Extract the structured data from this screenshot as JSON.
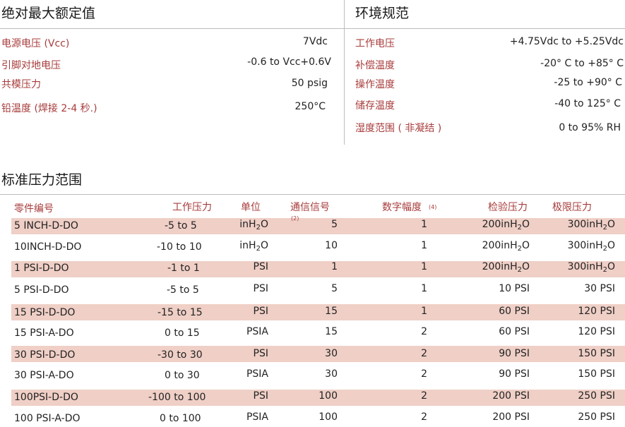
{
  "abs_max": {
    "title": "绝对最大额定值",
    "items": [
      {
        "label": "电源电压  (Vcc)",
        "value": "7Vdc"
      },
      {
        "label": "引脚对地电压",
        "value": "-0.6  to  Vcc+0.6V"
      },
      {
        "label": "共模压力",
        "value": "50  psig"
      },
      {
        "label": "铅温度  (焊接  2-4  秒.)",
        "value": "250°C"
      }
    ]
  },
  "env": {
    "title": "环境规范",
    "items": [
      {
        "label": "工作电压",
        "value": "+4.75Vdc   to  +5.25Vdc"
      },
      {
        "label": "补偿温度",
        "value": "-20°  C to  +85°  C"
      },
      {
        "label": "操作温度",
        "value": "-25  to  +90°  C"
      },
      {
        "label": "储存温度",
        "value": "-40  to 125°  C"
      },
      {
        "label": "湿度范围 ( 非凝结 )",
        "value": "0  to 95%   RH"
      }
    ]
  },
  "std": {
    "title": "标准压力范围",
    "headers": {
      "part": "零件编号",
      "range": "工作压力",
      "unit": "单位",
      "comm": "通信信号",
      "comm_note": "(2)",
      "digits": "数字幅度",
      "digits_note": "(4)",
      "proof": "检验压力",
      "burst": "极限压力"
    },
    "unit_inh2o": {
      "base": "inH",
      "sub": "2",
      "tail": "O"
    },
    "rows": [
      {
        "part": "5  INCH-D-DO",
        "range": "-5  to 5",
        "unit": "inH2O",
        "comm": "5",
        "digits": "1",
        "proof": "200inH2O",
        "burst": "300inH2O"
      },
      {
        "part": "10INCH-D-DO",
        "range": "-10 to 10",
        "unit": "inH2O",
        "comm": "10",
        "digits": "1",
        "proof": "200inH2O",
        "burst": "300inH2O"
      },
      {
        "part": "1 PSI-D-DO",
        "range": "-1 to 1",
        "unit": "PSI",
        "comm": "1",
        "digits": "1",
        "proof": "200inH2O",
        "burst": "300inH2O"
      },
      {
        "part": "5 PSI-D-DO",
        "range": "-5 to 5",
        "unit": "PSI",
        "comm": "5",
        "digits": "1",
        "proof": "10 PSI",
        "burst": "30 PSI"
      },
      {
        "part": "15  PSI-D-DO",
        "range": "-15 to 15",
        "unit": "PSI",
        "comm": "15",
        "digits": "1",
        "proof": "60 PSI",
        "burst": "120 PSI"
      },
      {
        "part": "15  PSI-A-DO",
        "range": "0 to 15",
        "unit": "PSIA",
        "comm": "15",
        "digits": "2",
        "proof": "60 PSI",
        "burst": "120 PSI"
      },
      {
        "part": "30 PSI-D-DO",
        "range": "-30 to 30",
        "unit": "PSI",
        "comm": "30",
        "digits": "2",
        "proof": "90 PSI",
        "burst": "150 PSI"
      },
      {
        "part": "30  PSI-A-DO",
        "range": "0 to 30",
        "unit": "PSIA",
        "comm": "30",
        "digits": "2",
        "proof": "90 PSI",
        "burst": "150 PSI"
      },
      {
        "part": "100PSI-D-DO",
        "range": "-100 to 100",
        "unit": "PSI",
        "comm": "100",
        "digits": "2",
        "proof": "200 PSI",
        "burst": "250 PSI"
      },
      {
        "part": "100   PSI-A-DO",
        "range": "0 to 100",
        "unit": "PSIA",
        "comm": "100",
        "digits": "2",
        "proof": "200 PSI",
        "burst": "250 PSI"
      }
    ]
  }
}
